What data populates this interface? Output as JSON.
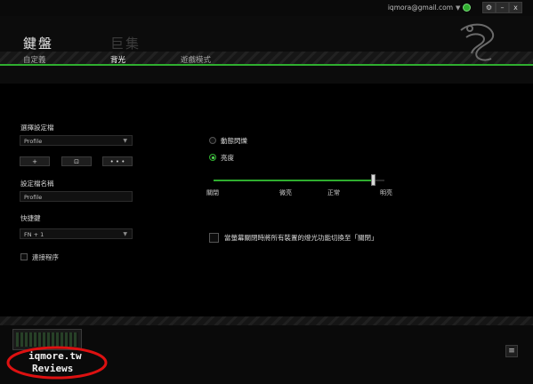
{
  "window": {
    "email": "iqmora@gmail.com",
    "settings_label": "⚙",
    "minimize_label": "–",
    "close_label": "x"
  },
  "tabs": {
    "keyboard": "鍵盤",
    "macro": "巨集"
  },
  "subtabs": [
    "自定義",
    "背光",
    "遊戲模式"
  ],
  "profile": {
    "select_label": "選擇設定檔",
    "selected": "Profile",
    "add_label": "+",
    "delete_label": "⊡",
    "more_label": "• • •",
    "name_label": "設定檔名稱",
    "name_value": "Profile",
    "hotkey_label": "快捷鍵",
    "hotkey_value": "FN + 1",
    "link_label": "連接程序"
  },
  "lighting": {
    "option1": "動態閃爍",
    "option2": "亮度",
    "brightness_level": 0.93,
    "ticks": [
      "關閉",
      "微亮",
      "正常",
      "明亮"
    ],
    "screen_off_text": "當螢幕關閉時將所有裝置的燈光功能切換至「關閉」"
  },
  "watermark": {
    "line1": "iqmore.tw",
    "line2": "Reviews"
  },
  "colors": {
    "accent": "#2fae2f",
    "background": "#000000"
  },
  "icons": [
    "razer-logo-icon",
    "settings-icon",
    "minimize-icon",
    "close-icon",
    "menu-icon",
    "keyboard-device-icon"
  ]
}
